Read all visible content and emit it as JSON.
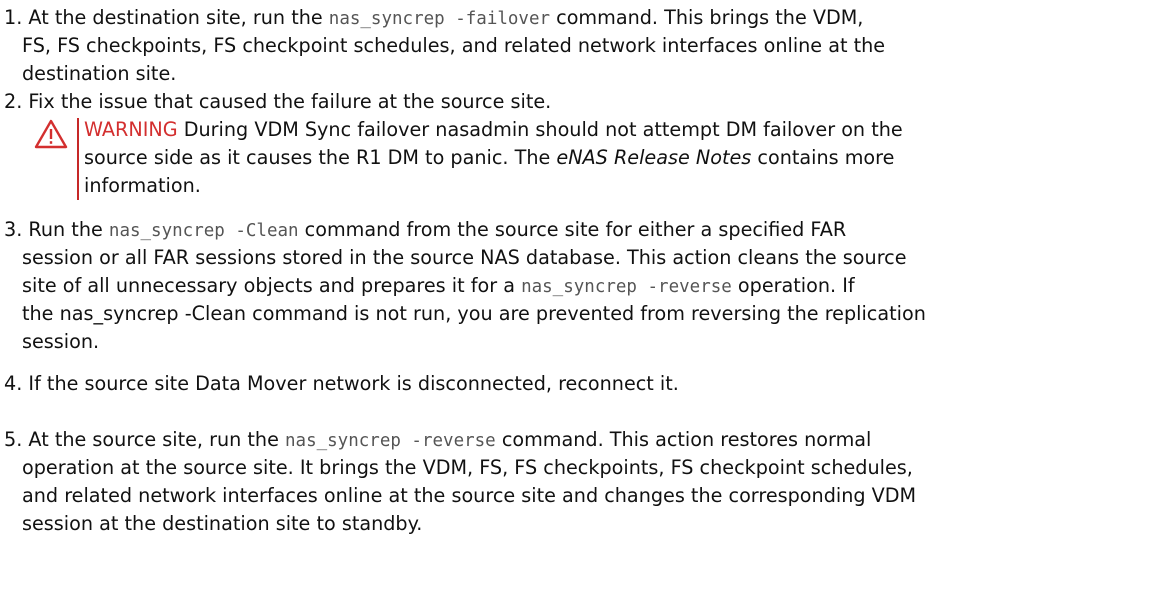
{
  "colors": {
    "warning": "#d32f2f",
    "text": "#111111",
    "code": "#555555"
  },
  "steps": [
    {
      "number": "1.",
      "lines": [
        {
          "a": "At the destination site, run the ",
          "code": "nas_syncrep -failover",
          "b": " command. This brings the VDM,"
        },
        {
          "a": "FS, FS checkpoints, FS checkpoint schedules, and related network interfaces online at the"
        },
        {
          "a": "destination site."
        }
      ]
    },
    {
      "number": "2.",
      "lines": [
        {
          "a": "Fix the issue that caused the failure at the source site."
        }
      ],
      "warning": {
        "icon": "warning-triangle-icon",
        "label": "WARNING",
        "line1": " During VDM Sync failover nasadmin should not attempt DM failover on the",
        "line2_a": "source side as it causes the R1 DM to panic. The ",
        "line2_em": "eNAS Release Notes",
        "line2_b": " contains more",
        "line3": "information."
      }
    },
    {
      "number": "3.",
      "lines": [
        {
          "a": "Run the ",
          "code": "nas_syncrep -Clean",
          "b": " command from the source site for either a specified FAR"
        },
        {
          "a": "session or all FAR sessions stored in the source NAS database. This action cleans the source"
        },
        {
          "a": "site of all unnecessary objects and prepares it for a ",
          "code": "nas_syncrep -reverse",
          "b": " operation. If"
        },
        {
          "a": "the nas_syncrep -Clean command is not run, you are prevented from reversing the replication"
        },
        {
          "a": "session."
        }
      ]
    },
    {
      "number": "4.",
      "lines": [
        {
          "a": "If the source site Data Mover network is disconnected, reconnect it."
        }
      ]
    },
    {
      "number": "5.",
      "lines": [
        {
          "a": "At the source site, run the ",
          "code": "nas_syncrep -reverse",
          "b": " command. This action restores normal"
        },
        {
          "a": "operation at the source site. It brings the VDM, FS, FS checkpoints, FS checkpoint schedules,"
        },
        {
          "a": "and related network interfaces online at the source site and changes the corresponding VDM"
        },
        {
          "a": "session at the destination site to standby."
        }
      ]
    }
  ]
}
